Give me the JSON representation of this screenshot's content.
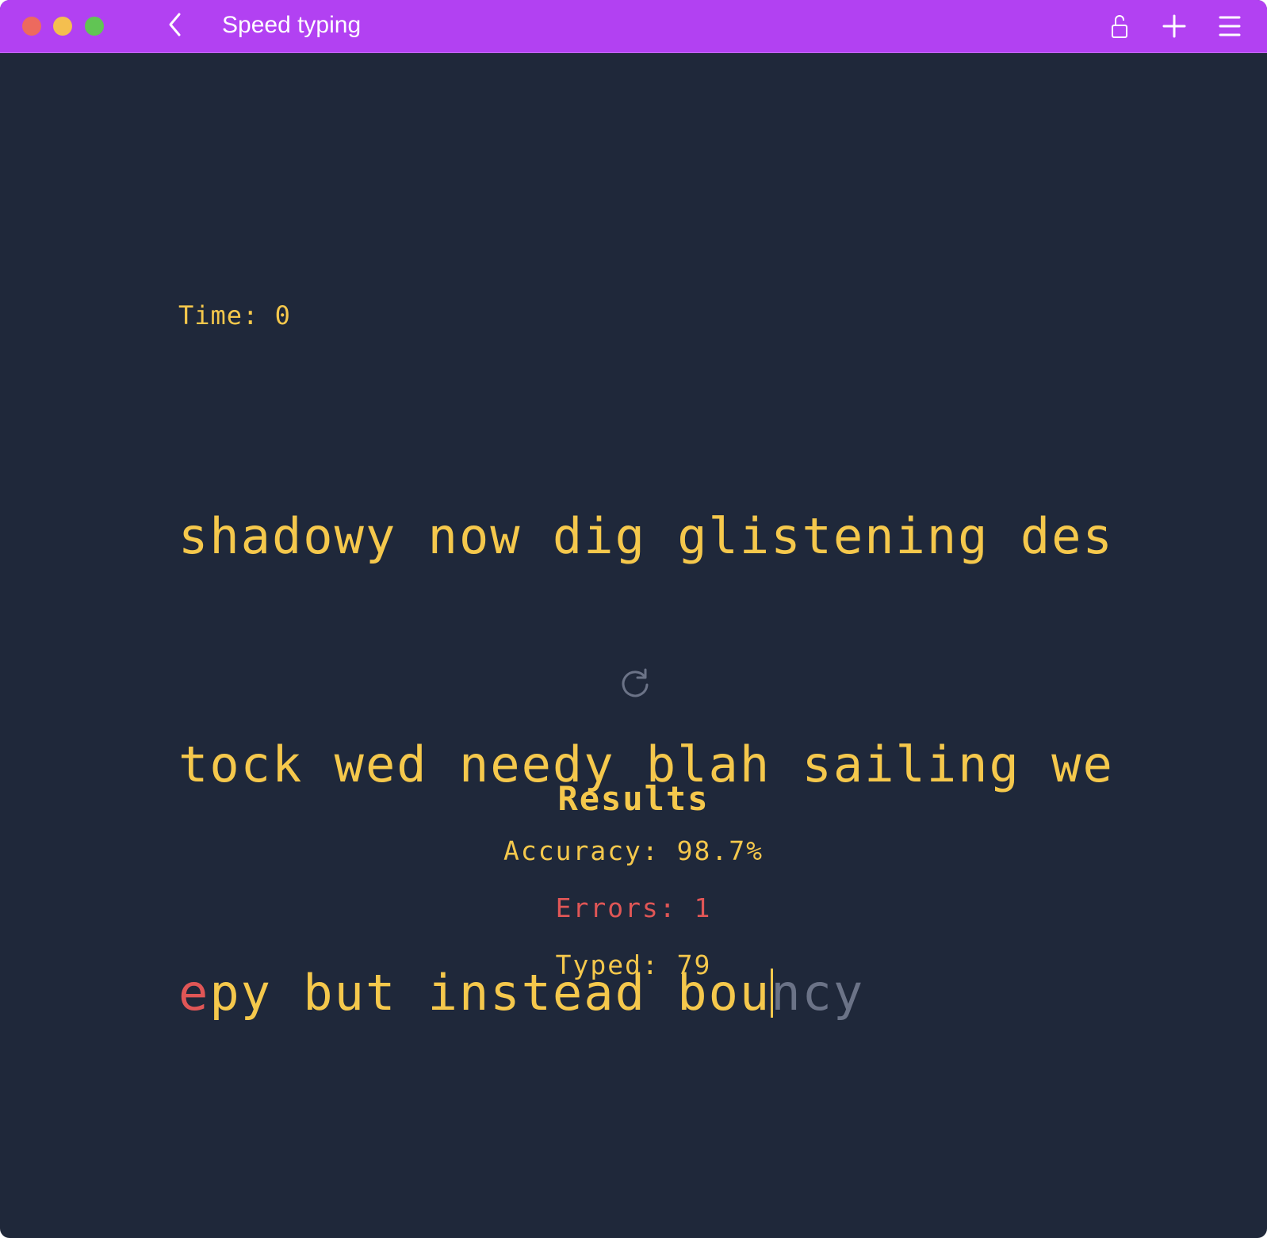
{
  "window": {
    "title": "Speed typing"
  },
  "colors": {
    "titlebar": "#b241f2",
    "background": "#1f283a",
    "text": "#f5c84c",
    "error": "#e05656",
    "pending": "#6b7387"
  },
  "icons": {
    "back": "chevron-left-icon",
    "lock": "unlock-icon",
    "add": "plus-icon",
    "menu": "hamburger-menu-icon",
    "restart": "refresh-icon"
  },
  "timer": {
    "text": "Time: 0"
  },
  "passage": {
    "line1": "shadowy now dig glistening des",
    "line2": "tock wed needy blah sailing we",
    "line3_error": "e",
    "line3_typed": "py but instead bou",
    "line3_pending": "ncy"
  },
  "results": {
    "title": "Results",
    "accuracy": "Accuracy: 98.7%",
    "errors": "Errors: 1",
    "typed": "Typed: 79"
  }
}
